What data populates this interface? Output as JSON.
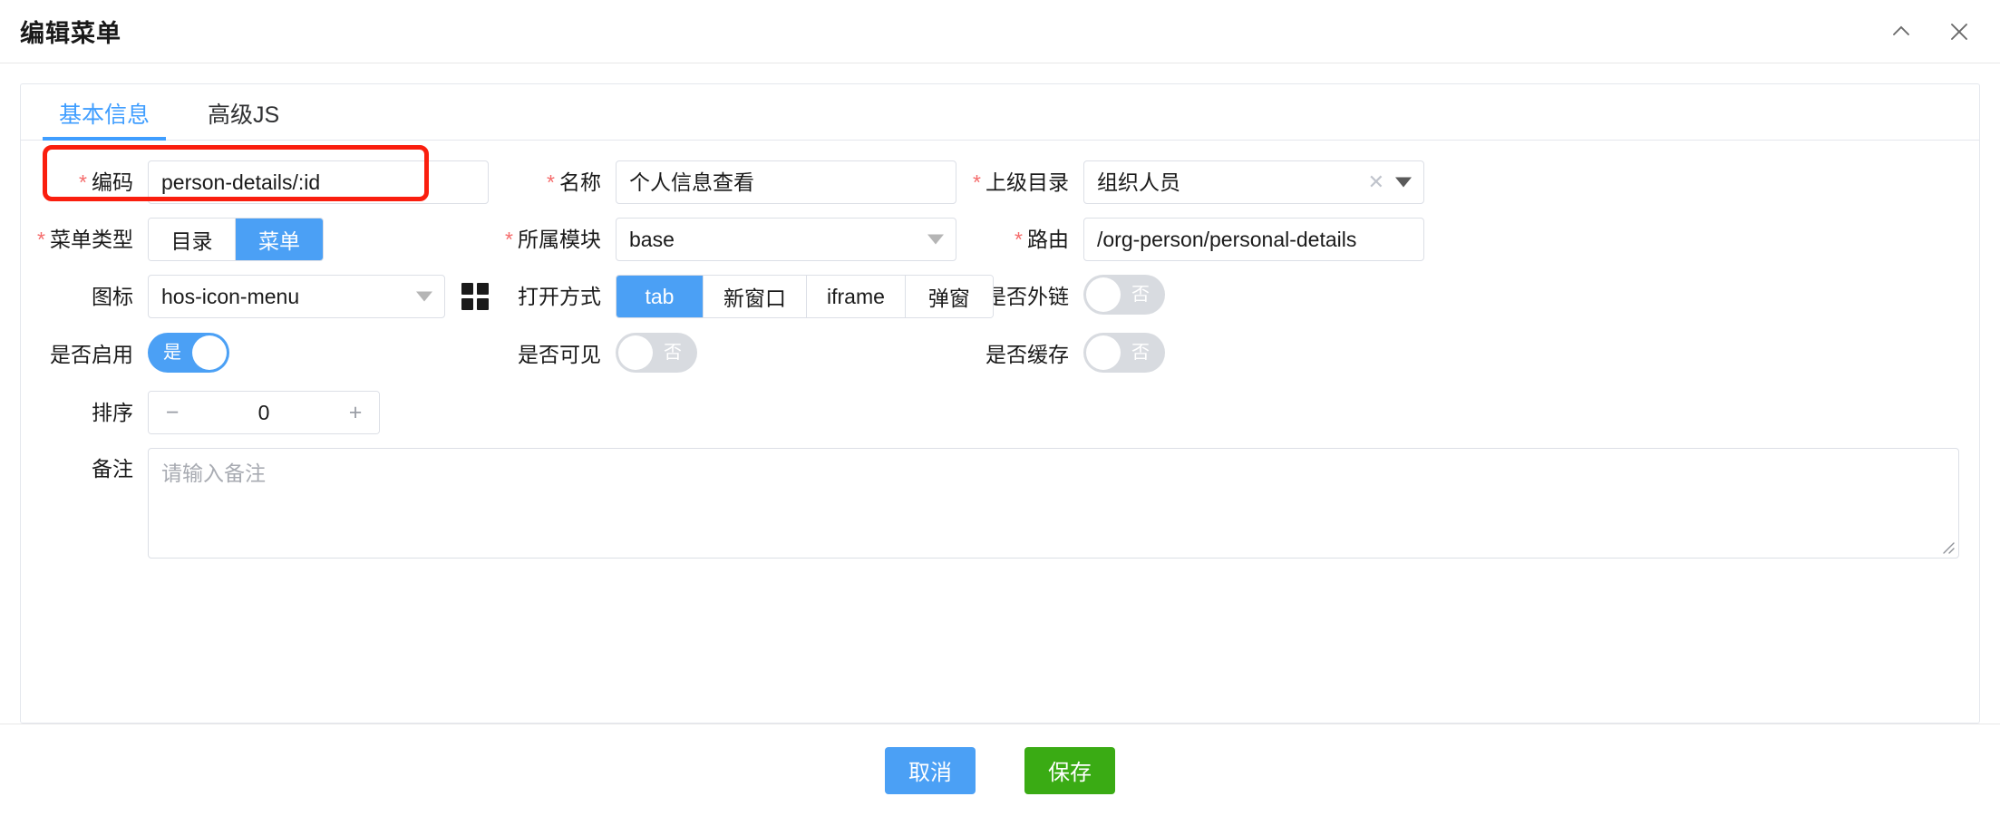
{
  "dialog": {
    "title": "编辑菜单",
    "collapse_icon": "chevron-up-icon",
    "close_icon": "close-icon"
  },
  "tabs": [
    {
      "label": "基本信息",
      "active": true
    },
    {
      "label": "高级JS",
      "active": false
    }
  ],
  "form": {
    "code": {
      "label": "编码",
      "required": true,
      "value": "person-details/:id",
      "highlighted": true
    },
    "name": {
      "label": "名称",
      "required": true,
      "value": "个人信息查看"
    },
    "parent_dir": {
      "label": "上级目录",
      "required": true,
      "value": "组织人员",
      "clear_icon": "clear-icon",
      "caret_icon": "chevron-down-icon"
    },
    "menu_type": {
      "label": "菜单类型",
      "required": true,
      "options": [
        "目录",
        "菜单"
      ],
      "selected": "菜单"
    },
    "module": {
      "label": "所属模块",
      "required": true,
      "value": "base",
      "caret_icon": "chevron-down-icon"
    },
    "route": {
      "label": "路由",
      "required": true,
      "value": "/org-person/personal-details"
    },
    "icon": {
      "label": "图标",
      "required": false,
      "value": "hos-icon-menu",
      "caret_icon": "chevron-down-icon",
      "picker_icon": "grid-icon"
    },
    "open_mode": {
      "label": "打开方式",
      "required": false,
      "options": [
        "tab",
        "新窗口",
        "iframe",
        "弹窗"
      ],
      "selected": "tab"
    },
    "external_link": {
      "label": "是否外链",
      "on": false,
      "state_text": "否"
    },
    "enabled": {
      "label": "是否启用",
      "on": true,
      "state_text": "是"
    },
    "visible": {
      "label": "是否可见",
      "on": false,
      "state_text": "否"
    },
    "cached": {
      "label": "是否缓存",
      "on": false,
      "state_text": "否"
    },
    "sort": {
      "label": "排序",
      "value": "0",
      "minus": "−",
      "plus": "+"
    },
    "remark": {
      "label": "备注",
      "value": "",
      "placeholder": "请输入备注"
    }
  },
  "footer": {
    "cancel_label": "取消",
    "save_label": "保存"
  },
  "colors": {
    "accent_blue": "#4ba0f5",
    "save_green": "#3aab14",
    "required_red": "#f56c6c",
    "highlight_red": "#fa1e0e",
    "tab_active": "#409eff"
  }
}
